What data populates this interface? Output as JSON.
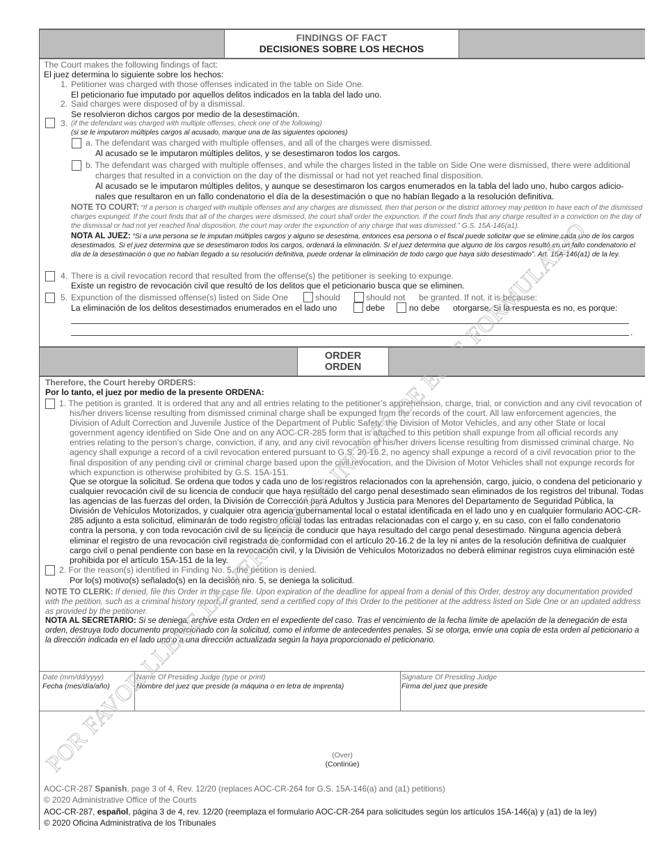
{
  "findings_header": {
    "en": "FINDINGS OF FACT",
    "es": "DECISIONES SOBRE LOS HECHOS"
  },
  "findings": {
    "intro_en": "The Court makes the following findings of fact:",
    "intro_es": "El juez determina lo siguiente sobre los hechos:",
    "item1": {
      "num": "1.",
      "en": "Petitioner was charged with those offenses indicated in the table on Side One.",
      "es": "El peticionario fue imputado por aquellos delitos indicados en la tabla del lado uno."
    },
    "item2": {
      "num": "2.",
      "en": "Said charges were disposed of by a dismissal.",
      "es": "Se resolvieron dichos cargos por medio de la desestimación."
    },
    "item3": {
      "num": "3.",
      "en": "(if the defendant was charged with multiple offenses, check one of the following)",
      "es": "(si se le imputaron múltiples cargos al acusado, marque una de las siguientes opciones)",
      "checked": false,
      "a": {
        "checked": false,
        "en": "a. The defendant was charged with multiple offenses, and all of the charges were dismissed.",
        "es": "Al acusado se le imputaron múltiples delitos, y se desestimaron todos los cargos."
      },
      "b": {
        "checked": false,
        "en1": "b. The defendant was charged with multiple offenses, and while the charges listed in the table on Side One were dismissed, there were additional",
        "en2": "charges that resulted in a conviction on the day of the dismissal or had not yet reached final disposition.",
        "es1": "Al acusado se le imputaron múltiples delitos, y aunque se desestimaron los cargos enumerados en la tabla del lado uno, hubo cargos adicio-",
        "es2": "nales que resultaron en un fallo condenatorio el día de la desestimación o que no habían llegado a la resolución definitiva."
      }
    },
    "note_court": {
      "label": "NOTE TO COURT:",
      "text": "“If a person is charged with multiple offenses and any charges are dismissed, then that person or the district attorney may petition to have each of the dismissed charges expunged. If the court finds that all of the charges were dismissed, the court shall order the expunction. If the court finds that any charge resulted in a conviction on the day of the dismissal or had not yet reached final disposition, the court may order the expunction of any charge that was dismissed.” G.S. 15A-146(a1).",
      "label_es": "NOTA AL JUEZ:",
      "text_es": "“Si a una persona se le imputan múltiples cargos y alguno se desestima, entonces esa persona o el fiscal puede solicitar que se elimine cada uno de los cargos desestimados. Si el juez determina que se desestimaron todos los cargos, ordenará la eliminación. Si el juez determina que alguno de los cargos resultó en un fallo condenatorio el día de la desestimación o que no habían llegado a su resolución definitiva, puede ordenar la eliminación de todo cargo que haya sido desestimado”. Art. 15A-146(a1) de la ley."
    },
    "item4": {
      "num": "4.",
      "checked": false,
      "en": "There is a civil revocation record that resulted from the offense(s) the petitioner is seeking to expunge.",
      "es": "Existe un registro de revocación civil que resultó de los delitos que el peticionario busca que se eliminen."
    },
    "item5": {
      "num": "5.",
      "checked": false,
      "en_pre": "Expunction of the dismissed offense(s) listed on Side One",
      "opt_should": "should",
      "opt_should_not": "should not",
      "en_post": "be granted. If not, it is because:",
      "es_pre": "La eliminación de los delitos desestimados enumerados en el lado uno",
      "opt_debe": "debe",
      "opt_no_debe": "no debe",
      "es_post": "otorgarse. Si la respuesta es no, es porque:",
      "should_checked": false,
      "should_not_checked": false,
      "reason_line1": "",
      "reason_line2": "",
      "end_period": "."
    }
  },
  "order_header": {
    "en": "ORDER",
    "es": "ORDEN"
  },
  "order": {
    "intro_en": "Therefore, the Court hereby ORDERS:",
    "intro_es": "Por lo tanto, el juez por medio de la presente ORDENA:",
    "item1": {
      "checked": false,
      "en": "1. The petition is granted. It is ordered that any and all entries relating to the petitioner’s apprehension, charge, trial, or conviction and any civil revocation of his/her drivers license resulting from dismissed criminal charge shall be expunged from the records of the court. All law enforcement agencies, the Division of Adult Correction and Juvenile Justice of the Department of Public Safety, the Division of Motor Vehicles, and any other State or local government agency identified on Side One and on any AOC-CR-285 form that is attached to this petition shall expunge from all official records any entries relating to the person’s charge, conviction, if any, and any civil revocation of his/her drivers license resulting from dismissed criminal charge. No agency shall expunge a record of a civil revocation entered pursuant to G.S. 20-16.2, no agency shall expunge a record of a civil revocation prior to the final disposition of any pending civil or criminal charge based upon the civil revocation, and the Division of Motor Vehicles shall not expunge records for which expunction is otherwise prohibited by G.S. 15A-151.",
      "es": "Que se otorgue la solicitud. Se ordena que todos y cada uno de los registros relacionados con la aprehensión, cargo, juicio, o condena del peticionario y cualquier revocación civil de su licencia de conducir que haya resultado del cargo penal desestimado sean eliminados de los registros del tribunal. Todas las agencias de las fuerzas del orden, la División de Corrección para Adultos y Justicia para Menores del Departamento de Seguridad Pública, la División de Vehículos Motorizados, y cualquier otra agencia gubernamental local o estatal identificada en el lado uno y en cualquier formulario AOC-CR-285 adjunto a esta solicitud, eliminarán de todo registro oficial todas las entradas relacionadas con el cargo y, en su caso, con el fallo condenatorio contra la persona, y con toda revocación civil de su licencia de conducir que haya resultado del cargo penal desestimado. Ninguna agencia deberá eliminar el registro de una revocación civil registrada de conformidad con el artículo 20-16.2 de la ley ni antes de la resolución definitiva de cualquier cargo civil o penal pendiente con base en la revocación civil, y la División de Vehículos Motorizados no deberá eliminar registros cuya eliminación esté prohibida por el artículo 15A-151 de la ley."
    },
    "item2": {
      "checked": false,
      "en": "2. For the reason(s) identified in Finding No. 5, the petition is denied.",
      "es": "Por lo(s) motivo(s) señalado(s) en la decisión nro. 5, se deniega la solicitud."
    },
    "note_clerk": {
      "label": "NOTE TO CLERK:",
      "text": "If denied, file this Order in the case file. Upon expiration of the deadline for appeal from a denial of this Order, destroy any documentation provided with the petition, such as a criminal history report. If granted, send a certified copy of this Order to the petitioner at the address listed on Side One or an updated address as provided by the petitioner.",
      "label_es": "NOTA AL SECRETARIO:",
      "text_es": "Si se deniega, archive esta Orden en el expediente del caso. Tras el vencimiento de la fecha límite de apelación de la denegación de esta orden, destruya todo documento proporcionado con la solicitud, como el informe de antecedentes penales. Si se otorga, envíe una copia de esta orden al peticionario a la dirección indicada en el lado uno o a una dirección actualizada según la haya proporcionado el peticionario."
    }
  },
  "signature": {
    "date_en": "Date (mm/dd/yyyy)",
    "date_es": "Fecha (mes/día/año)",
    "date_value": "",
    "name_en": "Name Of Presiding Judge (type or print)",
    "name_es": "Nombre del juez que preside (a máquina o en letra de imprenta)",
    "name_value": "",
    "sig_en": "Signature Of Presiding Judge",
    "sig_es": "Firma del juez que preside"
  },
  "over": {
    "en": "(Over)",
    "es": "(Continúe)"
  },
  "footer": {
    "line1_pre": "AOC-CR-287 ",
    "line1_bold": "Spanish",
    "line1_post": ", page 3 of 4, Rev. 12/20 (replaces AOC-CR-264 for G.S. 15A-146(a) and (a1) petitions)",
    "line2": "© 2020 Administrative Office of the Courts",
    "line3_pre": "AOC-CR-287, ",
    "line3_bold": "español",
    "line3_post": ", página 3 de 4, rev. 12/20 (reemplaza el formulario AOC-CR-264 para solicitudes según los artículos 15A-146(a) y (a1) de la ley)",
    "line4": "© 2020 Oficina Administrativa de los Tribunales"
  },
  "watermark": "POR FAVOR LLENE LA VERSIÓN EN INGLÉS DE ESTE FORMULARIO"
}
